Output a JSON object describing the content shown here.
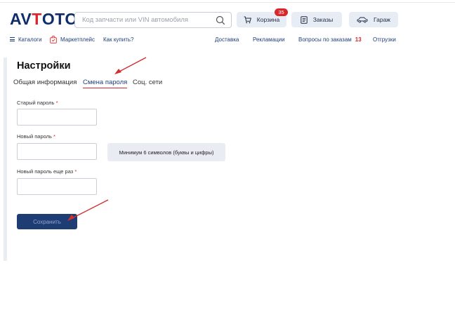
{
  "header": {
    "logo": {
      "part1": "AV",
      "part2": "T",
      "part3": "OTO"
    },
    "search": {
      "placeholder": "Код запчасти или VIN автомобиля",
      "value": ""
    },
    "cart": {
      "label": "Корзина",
      "count": "35"
    },
    "orders": {
      "label": "Заказы"
    },
    "garage": {
      "label": "Гараж"
    }
  },
  "nav": {
    "catalogs": "Каталоги",
    "marketplace": "Маркетплейс",
    "how_to_buy": "Как купить?",
    "delivery": "Доставка",
    "claims": "Рекламации",
    "order_questions": "Вопросы по заказам",
    "order_questions_count": "13",
    "shipments": "Отгрузки"
  },
  "page": {
    "title": "Настройки",
    "tabs": [
      {
        "label": "Общая информация",
        "active": false
      },
      {
        "label": "Смена пароля",
        "active": true
      },
      {
        "label": "Соц. сети",
        "active": false
      }
    ]
  },
  "form": {
    "old_password_label": "Старый пароль",
    "new_password_label": "Новый пароль",
    "repeat_password_label": "Новый пароль еще раз",
    "required_mark": "*",
    "hint": "Минимум 6 символов (буквы и цифры)",
    "save_label": "Сохранить"
  },
  "colors": {
    "brand_dark": "#0f2d6b",
    "brand_red": "#d8262a",
    "button_bg": "#1d3d74",
    "link": "#1d3f7a",
    "annotation_arrow": "#d32f2f"
  }
}
